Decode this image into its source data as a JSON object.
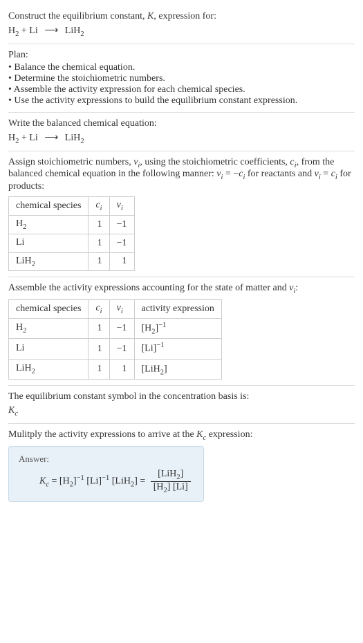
{
  "intro": {
    "prompt_line1": "Construct the equilibrium constant, ",
    "prompt_K": "K",
    "prompt_line1_after": ", expression for:",
    "eq_H2": "H",
    "eq_H2_sub": "2",
    "eq_plus": " + Li ",
    "eq_arrow": "⟶",
    "eq_LiH2": " LiH",
    "eq_LiH2_sub": "2"
  },
  "plan": {
    "title": "Plan:",
    "items": [
      "Balance the chemical equation.",
      "Determine the stoichiometric numbers.",
      "Assemble the activity expression for each chemical species.",
      "Use the activity expressions to build the equilibrium constant expression."
    ]
  },
  "balanced": {
    "title": "Write the balanced chemical equation:",
    "eq_H2": "H",
    "eq_H2_sub": "2",
    "eq_plus": " + Li ",
    "eq_arrow": "⟶",
    "eq_LiH2": " LiH",
    "eq_LiH2_sub": "2"
  },
  "stoich": {
    "text1": "Assign stoichiometric numbers, ",
    "nu_i": "ν",
    "nu_i_sub": "i",
    "text2": ", using the stoichiometric coefficients, ",
    "c_i": "c",
    "c_i_sub": "i",
    "text3": ", from the balanced chemical equation in the following manner: ",
    "rel1_a": "ν",
    "rel1_a_sub": "i",
    "rel1_eq": " = −",
    "rel1_b": "c",
    "rel1_b_sub": "i",
    "text4": " for reactants and ",
    "rel2_a": "ν",
    "rel2_a_sub": "i",
    "rel2_eq": " = ",
    "rel2_b": "c",
    "rel2_b_sub": "i",
    "text5": " for products:",
    "headers": {
      "species": "chemical species",
      "ci": "c",
      "ci_sub": "i",
      "nui": "ν",
      "nui_sub": "i"
    },
    "rows": [
      {
        "species": "H",
        "species_sub": "2",
        "ci": "1",
        "nui": "−1"
      },
      {
        "species": "Li",
        "species_sub": "",
        "ci": "1",
        "nui": "−1"
      },
      {
        "species": "LiH",
        "species_sub": "2",
        "ci": "1",
        "nui": "1"
      }
    ]
  },
  "activity": {
    "text1": "Assemble the activity expressions accounting for the state of matter and ",
    "nu_i": "ν",
    "nu_i_sub": "i",
    "text2": ":",
    "headers": {
      "species": "chemical species",
      "ci": "c",
      "ci_sub": "i",
      "nui": "ν",
      "nui_sub": "i",
      "act": "activity expression"
    },
    "rows": [
      {
        "species": "H",
        "species_sub": "2",
        "ci": "1",
        "nui": "−1",
        "act_l": "[H",
        "act_sub": "2",
        "act_r": "]",
        "act_sup": "−1"
      },
      {
        "species": "Li",
        "species_sub": "",
        "ci": "1",
        "nui": "−1",
        "act_l": "[Li",
        "act_sub": "",
        "act_r": "]",
        "act_sup": "−1"
      },
      {
        "species": "LiH",
        "species_sub": "2",
        "ci": "1",
        "nui": "1",
        "act_l": "[LiH",
        "act_sub": "2",
        "act_r": "]",
        "act_sup": ""
      }
    ]
  },
  "symbol": {
    "text": "The equilibrium constant symbol in the concentration basis is:",
    "Kc": "K",
    "Kc_sub": "c"
  },
  "multiply": {
    "text1": "Mulitply the activity expressions to arrive at the ",
    "Kc": "K",
    "Kc_sub": "c",
    "text2": " expression:"
  },
  "answer": {
    "label": "Answer:",
    "lhs_K": "K",
    "lhs_K_sub": "c",
    "eq": " = ",
    "t1_l": "[H",
    "t1_sub": "2",
    "t1_r": "]",
    "t1_sup": "−1",
    "t2_l": " [Li]",
    "t2_sup": "−1",
    "t3_l": " [LiH",
    "t3_sub": "2",
    "t3_r": "] = ",
    "num_l": "[LiH",
    "num_sub": "2",
    "num_r": "]",
    "den_l1": "[H",
    "den_sub1": "2",
    "den_r1": "] ",
    "den_l2": "[Li]"
  }
}
